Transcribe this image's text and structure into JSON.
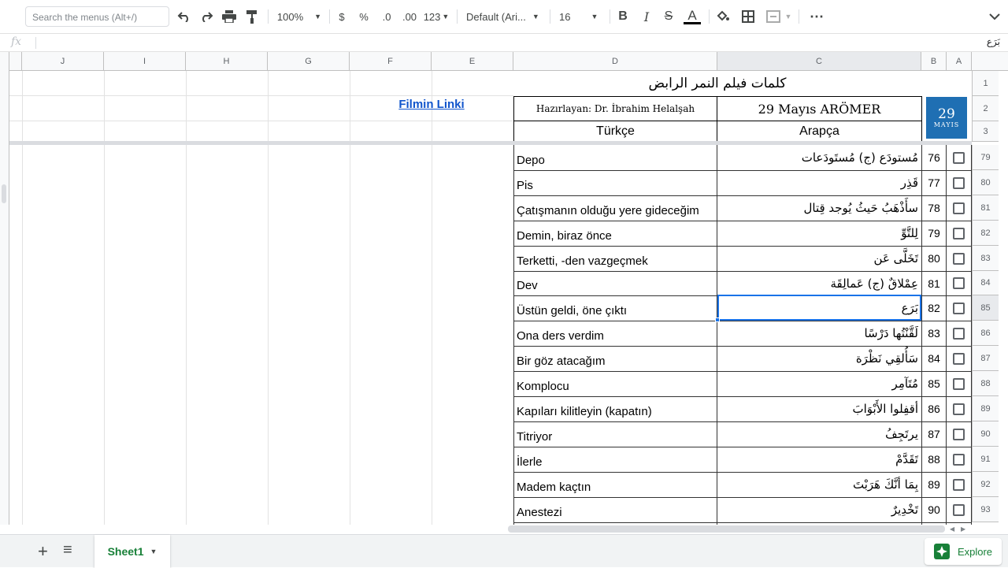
{
  "toolbar": {
    "search_placeholder": "Search the menus (Alt+/)",
    "zoom": "100%",
    "currency": "$",
    "percent": "%",
    "dec_less": ".0",
    "dec_more": ".00",
    "format_more": "123",
    "font": "Default (Ari...",
    "font_size": "16",
    "bold": "B",
    "italic": "I",
    "strike": "S",
    "text_color": "A",
    "more": "⋯"
  },
  "formula_bar": {
    "fx": "fx",
    "value": "بَرَع"
  },
  "columns": [
    "J",
    "I",
    "H",
    "G",
    "F",
    "E",
    "D",
    "C",
    "B",
    "A"
  ],
  "header_rows": [
    "1",
    "2",
    "3"
  ],
  "sheet": {
    "title_ar": "كلمات فيلم النمر الرابض",
    "link": "Filmin Linki",
    "prepared": "Hazırlayan: Dr. İbrahim Helalşah",
    "institution": "29 Mayıs ARÖMER",
    "col_turkish": "Türkçe",
    "col_arabic": "Arapça",
    "logo_number": "29",
    "logo_text": "MAYIS"
  },
  "rows": [
    {
      "row": "79",
      "num": "76",
      "tr": "Depo",
      "ar": "مُستودَع (ج) مُستَودَعات"
    },
    {
      "row": "80",
      "num": "77",
      "tr": "Pis",
      "ar": "قَذِر"
    },
    {
      "row": "81",
      "num": "78",
      "tr": "Çatışmanın olduğu yere gideceğim",
      "ar": "سأَذْهَبُ حَيثُ يُوجد قِتال"
    },
    {
      "row": "82",
      "num": "79",
      "tr": "Demin, biraz önce",
      "ar": "لِلتَّوِّ"
    },
    {
      "row": "83",
      "num": "80",
      "tr": "Terketti, -den vazgeçmek",
      "ar": "تَخَلَّى عَن"
    },
    {
      "row": "84",
      "num": "81",
      "tr": "Dev",
      "ar": "عِمْلاقٌ (ج) عَمالِقَة"
    },
    {
      "row": "85",
      "num": "82",
      "tr": "Üstün geldi, öne çıktı",
      "ar": "بَرَع"
    },
    {
      "row": "86",
      "num": "83",
      "tr": "Ona ders verdim",
      "ar": "لَقَّنْتُها دَرْسًا"
    },
    {
      "row": "87",
      "num": "84",
      "tr": "Bir göz atacağım",
      "ar": "سَأُلقِي نَظْرَة"
    },
    {
      "row": "88",
      "num": "85",
      "tr": "Komplocu",
      "ar": "مُتَآمِر"
    },
    {
      "row": "89",
      "num": "86",
      "tr": "Kapıları kilitleyin (kapatın)",
      "ar": "أقفِلوا الأَبْوَابَ"
    },
    {
      "row": "90",
      "num": "87",
      "tr": "Titriyor",
      "ar": "يرتَجِفُ"
    },
    {
      "row": "91",
      "num": "88",
      "tr": "İlerle",
      "ar": "تَقَدَّمْ"
    },
    {
      "row": "92",
      "num": "89",
      "tr": "Madem kaçtın",
      "ar": "بِمَا أنَّكَ هَرَبْتَ"
    },
    {
      "row": "93",
      "num": "90",
      "tr": "Anestezi",
      "ar": "تَخْدِيرٌ"
    }
  ],
  "bottom": {
    "add": "+",
    "list": "≡",
    "sheet_tab": "Sheet1",
    "explore": "Explore"
  },
  "colors": {
    "selection": "#1a73e8",
    "link": "#1155cc",
    "sheet_green": "#188038"
  }
}
